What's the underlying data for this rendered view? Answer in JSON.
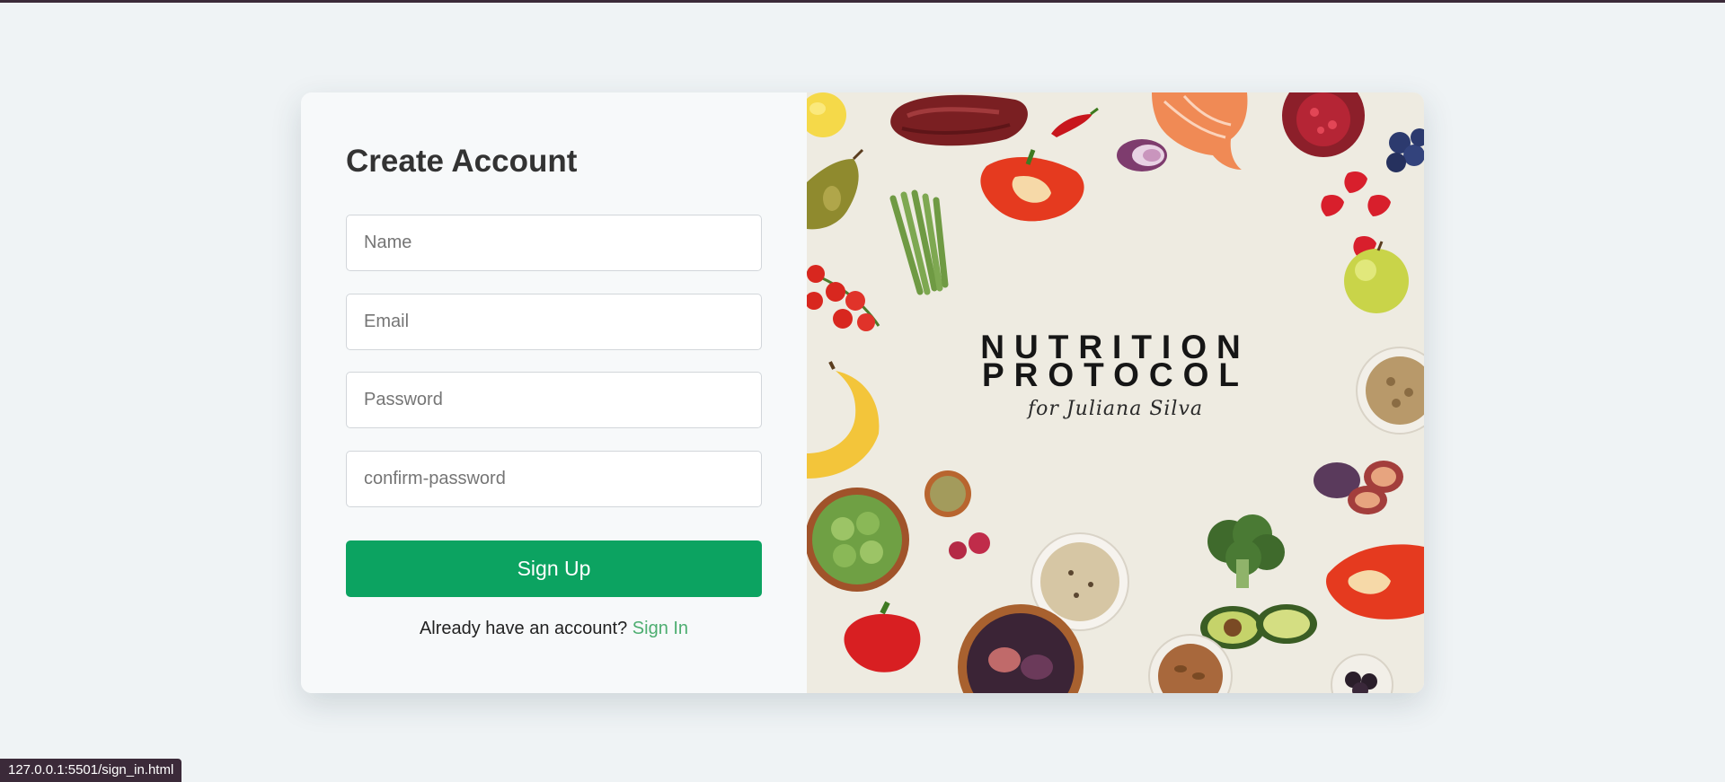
{
  "form": {
    "title": "Create Account",
    "fields": {
      "name": {
        "placeholder": "Name",
        "value": ""
      },
      "email": {
        "placeholder": "Email",
        "value": ""
      },
      "password": {
        "placeholder": "Password",
        "value": ""
      },
      "confirm_password": {
        "placeholder": "confirm-password",
        "value": ""
      }
    },
    "submit_label": "Sign Up",
    "signin_prompt": "Already have an account?",
    "signin_link": "Sign In"
  },
  "cover": {
    "title_line1": "NUTRITION",
    "title_line2": "PROTOCOL",
    "subtitle": "for Juliana Silva",
    "food_icons": [
      "lemon-icon",
      "steak-icon",
      "chili-icon",
      "salmon-icon",
      "pomegranate-icon",
      "pear-icon",
      "bell-pepper-icon",
      "onion-icon",
      "blueberries-icon",
      "strawberries-icon",
      "asparagus-icon",
      "cherry-tomatoes-icon",
      "apple-icon",
      "banana-icon",
      "chickpeas-bowl-icon",
      "seeds-bowl-icon",
      "figs-icon",
      "brussels-sprouts-bowl-icon",
      "raspberries-icon",
      "rice-bowl-icon",
      "broccoli-icon",
      "avocado-icon",
      "almonds-bowl-icon",
      "blackberries-bowl-icon"
    ]
  },
  "status_bar": {
    "url": "127.0.0.1:5501/sign_in.html"
  },
  "colors": {
    "page_background": "#eff3f5",
    "primary_button": "#0ca361",
    "link": "#4cad6f",
    "cover_background": "#eeebe1"
  }
}
